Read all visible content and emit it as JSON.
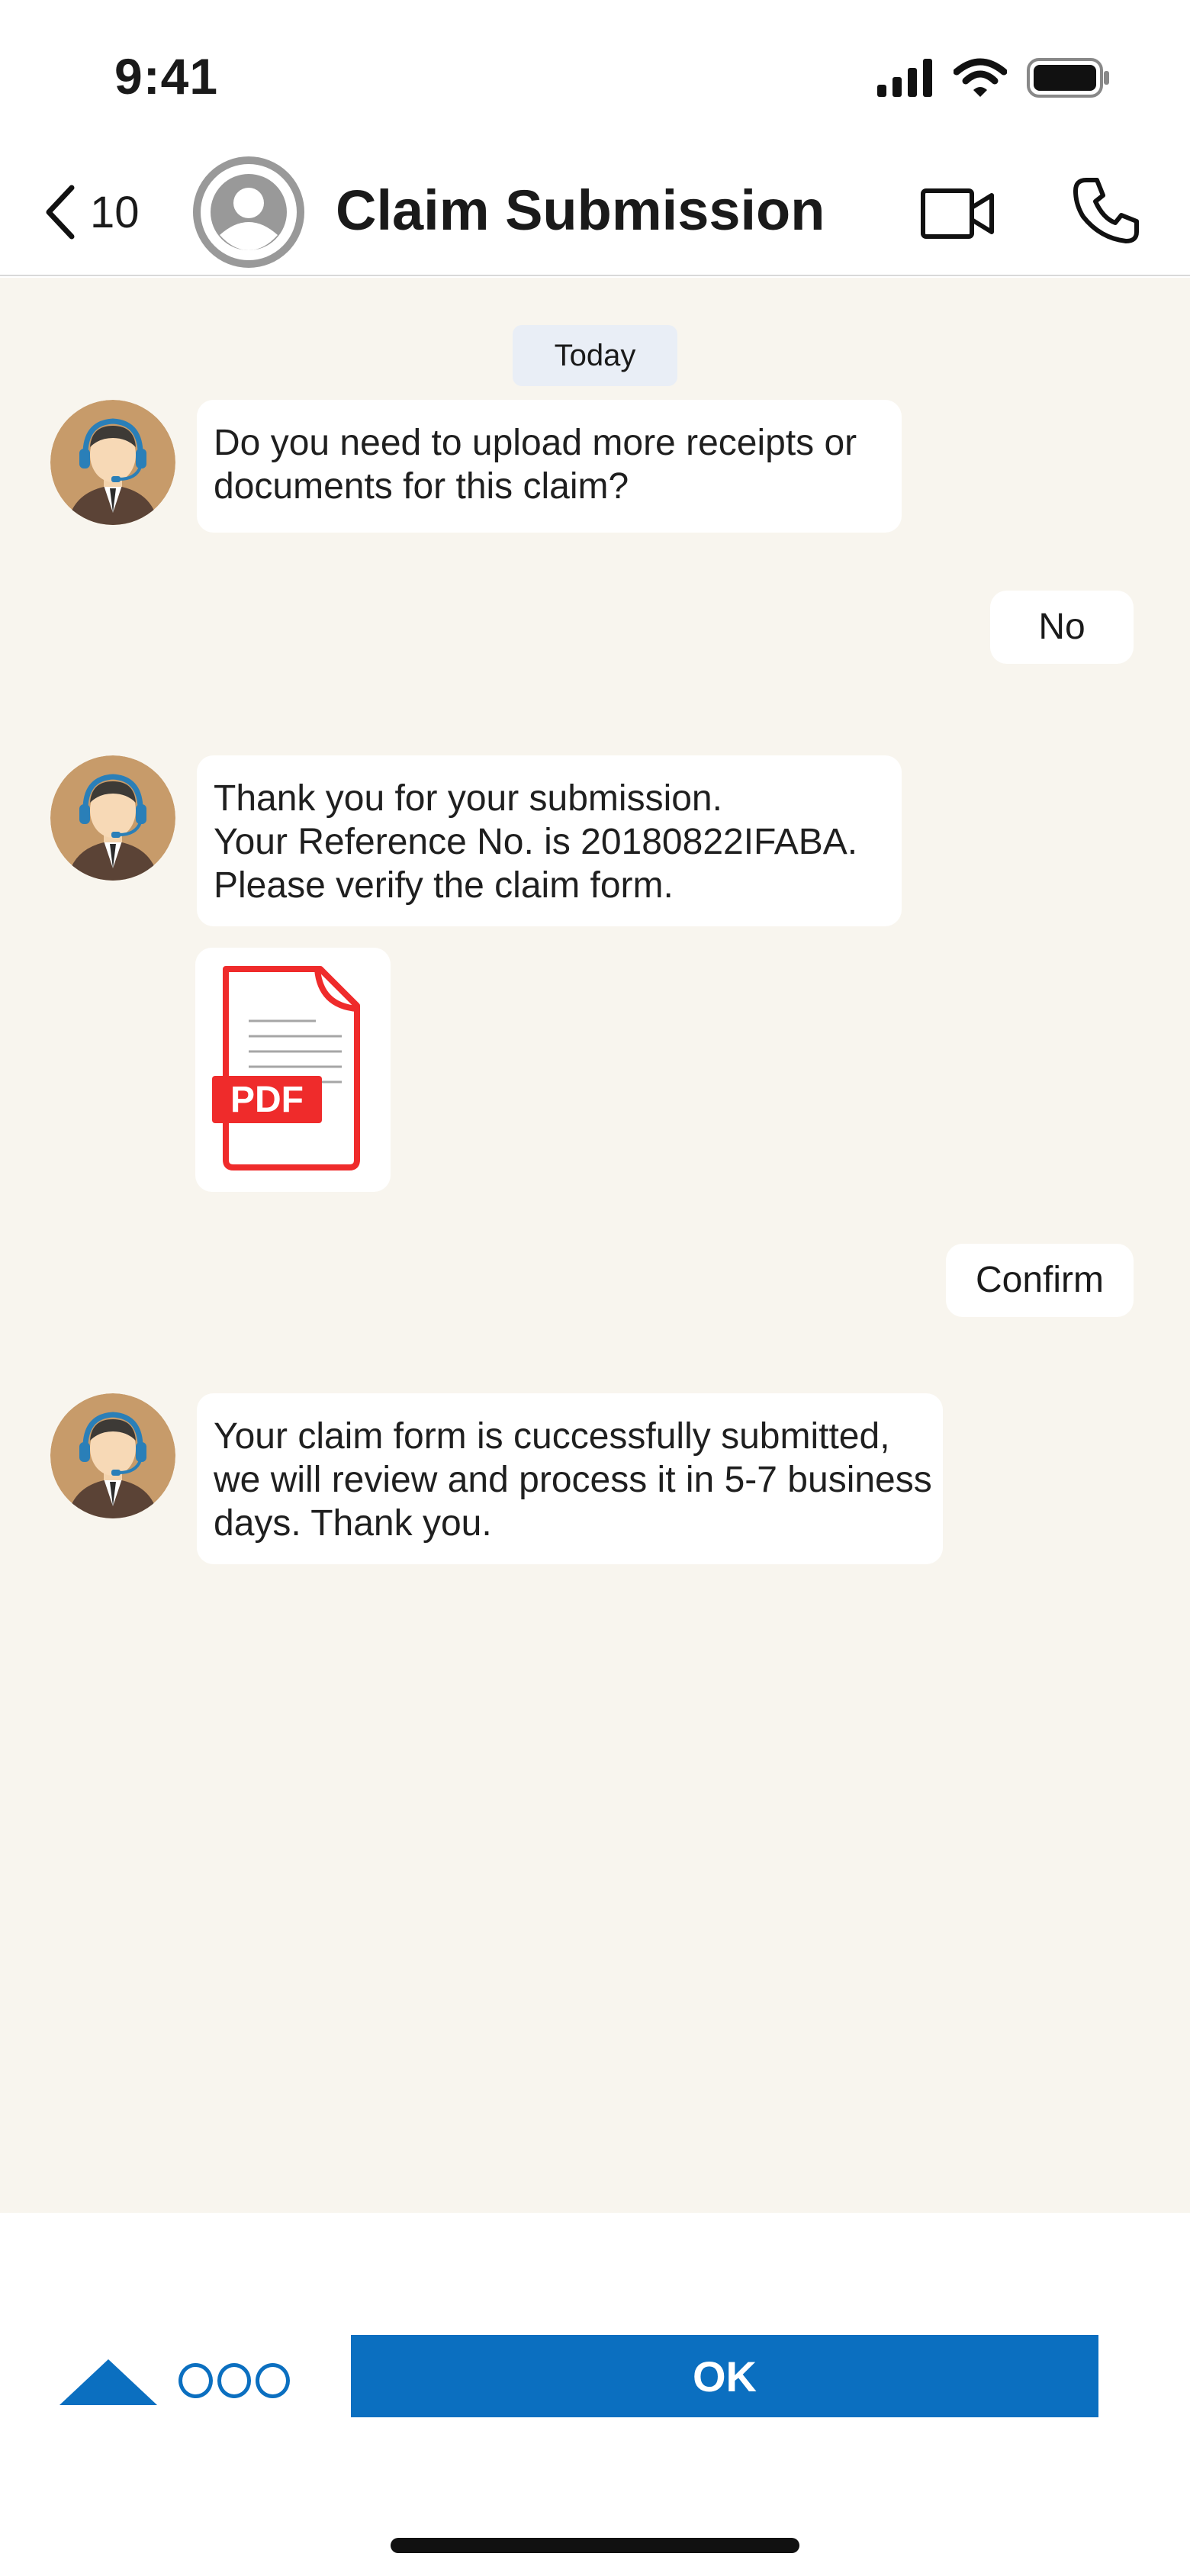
{
  "status_bar": {
    "time": "9:41",
    "icons": [
      "signal-icon",
      "wifi-icon",
      "battery-icon"
    ]
  },
  "nav": {
    "back_count": "10",
    "title": "Claim Submission",
    "icons": [
      "chevron-left-icon",
      "contact-avatar-icon",
      "video-call-icon",
      "phone-icon"
    ]
  },
  "chat": {
    "date_label": "Today",
    "messages": [
      {
        "from": "agent",
        "lines": [
          "Do you need to upload more receipts or",
          "documents for this claim?"
        ]
      },
      {
        "from": "user",
        "text": "No"
      },
      {
        "from": "agent",
        "lines": [
          "Thank you for your submission.",
          "Your Reference No. is 20180822IFABA.",
          "Please verify the claim form."
        ]
      },
      {
        "from": "agent",
        "attachment": {
          "type": "pdf",
          "label": "PDF"
        }
      },
      {
        "from": "user",
        "text": "Confirm"
      },
      {
        "from": "agent",
        "lines": [
          "Your claim form is cuccessfully submitted,",
          "we will review and process it in 5-7 business",
          "days. Thank you."
        ]
      }
    ]
  },
  "bottom": {
    "ok_label": "OK",
    "icons": [
      "triangle-up-icon",
      "more-dots-icon"
    ]
  },
  "colors": {
    "accent": "#0b6fc0",
    "chat_background": "#f8f5ee",
    "bubble": "#ffffff",
    "pdf_red": "#ef2b2b"
  }
}
